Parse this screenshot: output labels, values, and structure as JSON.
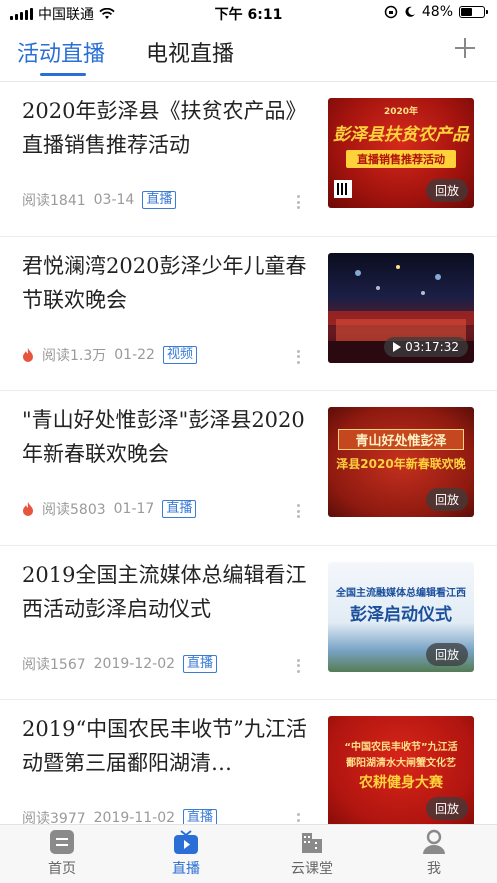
{
  "status_bar": {
    "carrier": "中国联通",
    "time": "下午 6:11",
    "battery_percent": "48%",
    "battery_level": 0.48
  },
  "header": {
    "tabs": [
      {
        "label": "活动直播",
        "active": true
      },
      {
        "label": "电视直播",
        "active": false
      }
    ],
    "add_icon": "plus-icon"
  },
  "feed": [
    {
      "title": "2020年彭泽县《扶贫农产品》直播销售推荐活动",
      "reads": "阅读1841",
      "date": "03-14",
      "badge": "直播",
      "hot": false,
      "thumb_label": "回放",
      "thumb_texts": [
        "2020年",
        "彭泽县扶贫农产品",
        "直播销售推荐活动"
      ]
    },
    {
      "title": "君悦澜湾2020彭泽少年儿童春节联欢晚会",
      "reads": "阅读1.3万",
      "date": "01-22",
      "badge": "视频",
      "hot": true,
      "thumb_label": "03:17:32",
      "thumb_texts": []
    },
    {
      "title": "\"青山好处惟彭泽\"彭泽县2020年新春联欢晚会",
      "reads": "阅读5803",
      "date": "01-17",
      "badge": "直播",
      "hot": true,
      "thumb_label": "回放",
      "thumb_texts": [
        "青山好处惟彭泽",
        "泽县2020年新春联欢晚"
      ]
    },
    {
      "title": "2019全国主流媒体总编辑看江西活动彭泽启动仪式",
      "reads": "阅读1567",
      "date": "2019-12-02",
      "badge": "直播",
      "hot": false,
      "thumb_label": "回放",
      "thumb_texts": [
        "全国主流融媒体总编辑看江西",
        "彭泽启动仪式"
      ]
    },
    {
      "title": "2019“中国农民丰收节”九江活动暨第三届鄱阳湖清…",
      "reads": "阅读3977",
      "date": "2019-11-02",
      "badge": "直播",
      "hot": false,
      "thumb_label": "回放",
      "thumb_texts": [
        "“中国农民丰收节”九江活",
        "鄱阳湖清水大闸蟹文化艺",
        "农耕健身大赛"
      ]
    }
  ],
  "bottom_nav": [
    {
      "label": "首页",
      "icon": "home-doc-icon",
      "active": false
    },
    {
      "label": "直播",
      "icon": "tv-icon",
      "active": true
    },
    {
      "label": "云课堂",
      "icon": "building-icon",
      "active": false
    },
    {
      "label": "我",
      "icon": "person-icon",
      "active": false
    }
  ],
  "colors": {
    "accent": "#2a6fd6",
    "hot": "#e8553e"
  }
}
